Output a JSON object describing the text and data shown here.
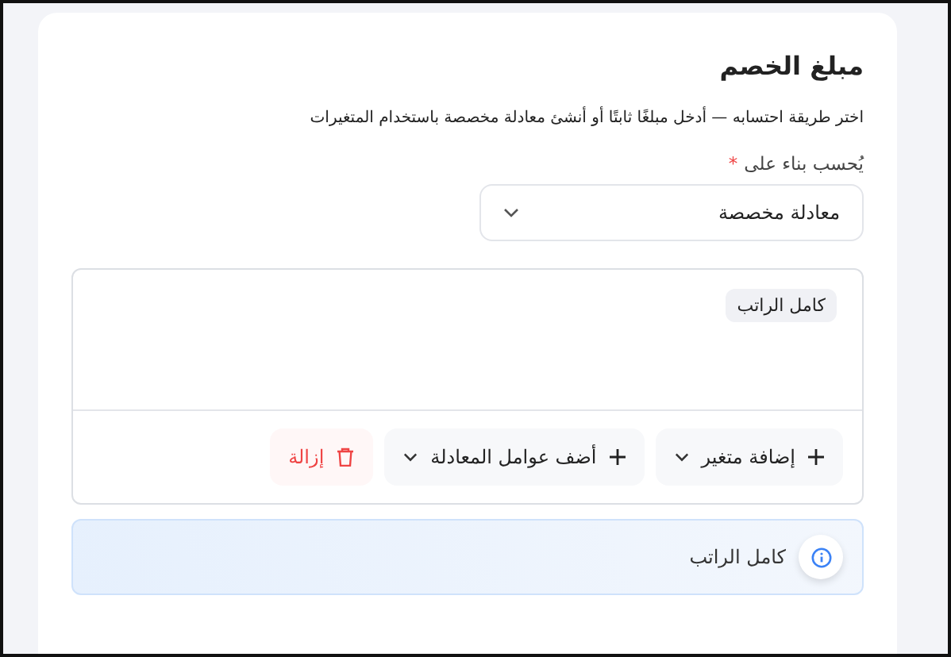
{
  "section": {
    "title": "مبلغ الخصم",
    "description": "اختر طريقة احتسابه — أدخل مبلغًا ثابتًا أو أنشئ معادلة مخصصة باستخدام المتغيرات"
  },
  "basis": {
    "label": "يُحسب بناء على",
    "required_mark": "*",
    "value": "معادلة مخصصة"
  },
  "formula": {
    "tokens": [
      "كامل الراتب"
    ],
    "actions": [
      {
        "kind": "add-menu",
        "label": "إضافة متغير"
      },
      {
        "kind": "add-menu",
        "label": "أضف عوامل المعادلة"
      },
      {
        "kind": "remove",
        "label": "إزالة"
      }
    ]
  },
  "preview": {
    "text": "كامل الراتب"
  }
}
